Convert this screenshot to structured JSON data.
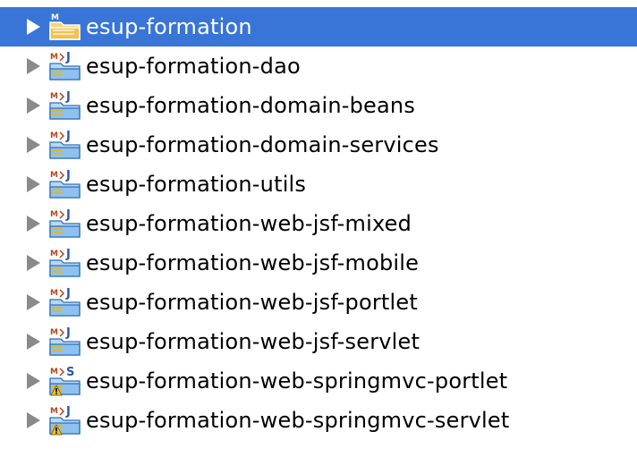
{
  "tree": {
    "items": [
      {
        "label": "esup-formation",
        "selected": true,
        "nature": "maven",
        "warning": false
      },
      {
        "label": "esup-formation-dao",
        "selected": false,
        "nature": "java",
        "warning": false
      },
      {
        "label": "esup-formation-domain-beans",
        "selected": false,
        "nature": "java",
        "warning": false
      },
      {
        "label": "esup-formation-domain-services",
        "selected": false,
        "nature": "java",
        "warning": false
      },
      {
        "label": "esup-formation-utils",
        "selected": false,
        "nature": "java",
        "warning": false
      },
      {
        "label": "esup-formation-web-jsf-mixed",
        "selected": false,
        "nature": "java",
        "warning": false
      },
      {
        "label": "esup-formation-web-jsf-mobile",
        "selected": false,
        "nature": "java",
        "warning": false
      },
      {
        "label": "esup-formation-web-jsf-portlet",
        "selected": false,
        "nature": "java",
        "warning": false
      },
      {
        "label": "esup-formation-web-jsf-servlet",
        "selected": false,
        "nature": "java",
        "warning": false
      },
      {
        "label": "esup-formation-web-springmvc-portlet",
        "selected": false,
        "nature": "spring",
        "warning": true
      },
      {
        "label": "esup-formation-web-springmvc-servlet",
        "selected": false,
        "nature": "java",
        "warning": true
      }
    ],
    "icons": {
      "expand": "expand-triangle-icon",
      "project_folder": "project-folder-icon",
      "maven_badge": "maven-badge-icon",
      "java_badge": "java-nature-icon",
      "spring_badge": "spring-nature-icon",
      "warning_badge": "warning-badge-icon"
    },
    "colors": {
      "selection": "#3875d7",
      "folder_fill": "#8fc1f0",
      "folder_stroke": "#2f6fb8",
      "maven_badge": "#b5451b",
      "java_badge": "#2b58a6",
      "spring_badge": "#2b58a6",
      "warning": "#f2c230",
      "triangle": "#8a8a8a"
    }
  }
}
